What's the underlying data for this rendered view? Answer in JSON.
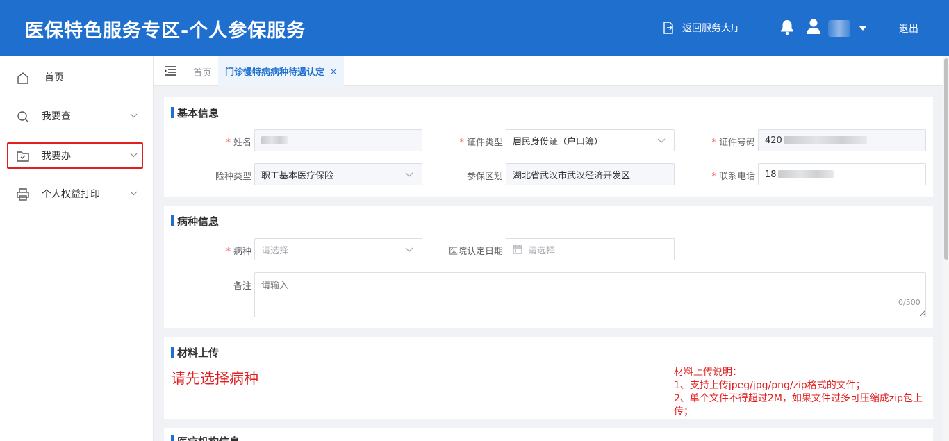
{
  "header": {
    "title": "医保特色服务专区-个人参保服务",
    "back_label": "返回服务大厅",
    "logout_label": "退出",
    "icons": [
      "exit-icon",
      "bell-icon",
      "user-icon",
      "caret-down-icon"
    ]
  },
  "sidebar": {
    "items": [
      {
        "label": "首页",
        "icon": "home-icon"
      },
      {
        "label": "我要查",
        "icon": "search-icon"
      },
      {
        "label": "我要办",
        "icon": "folder-check-icon"
      },
      {
        "label": "个人权益打印",
        "icon": "printer-icon"
      }
    ]
  },
  "tabs": {
    "home": "首页",
    "active": "门诊慢特病病种待遇认定",
    "close": "×"
  },
  "basic": {
    "title": "基本信息",
    "name_label": "姓名",
    "idtype_label": "证件类型",
    "idtype_value": "居民身份证（户口簿）",
    "idno_label": "证件号码",
    "idno_prefix": "420",
    "insurance_label": "险种类型",
    "insurance_value": "职工基本医疗保险",
    "area_label": "参保区划",
    "area_value": "湖北省武汉市武汉经济开发区",
    "phone_label": "联系电话",
    "phone_prefix": "18"
  },
  "disease": {
    "title": "病种信息",
    "disease_label": "病种",
    "disease_placeholder": "请选择",
    "date_label": "医院认定日期",
    "date_placeholder": "请选择",
    "remark_label": "备注",
    "remark_placeholder": "请输入",
    "counter": "0/500"
  },
  "upload": {
    "title": "材料上传",
    "hint": "请先选择病种",
    "desc_title": "材料上传说明：",
    "desc_1": "1、支持上传jpeg/jpg/png/zip格式的文件；",
    "desc_2": "2、单个文件不得超过2M，如果文件过多可压缩成zip包上传；"
  },
  "institution": {
    "title": "医疗机构信息"
  },
  "colors": {
    "primary": "#1f6fcf",
    "error": "#e02020"
  }
}
